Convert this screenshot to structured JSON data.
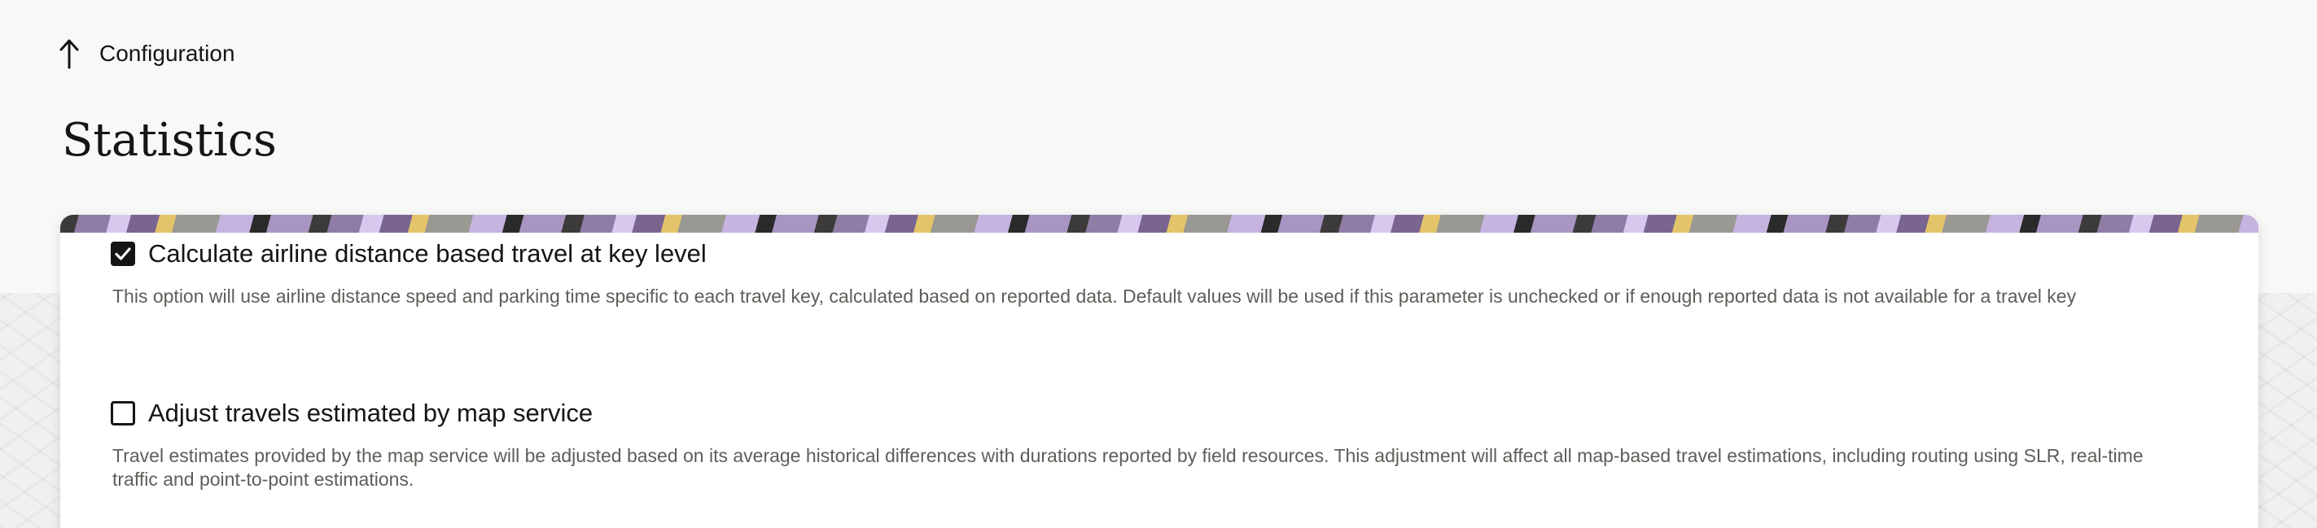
{
  "nav": {
    "up_label": "Configuration",
    "up_icon": "arrow-up-icon"
  },
  "page": {
    "title": "Statistics"
  },
  "options": [
    {
      "label": "Calculate airline distance based travel at key level",
      "checked": true,
      "description": "This option will use airline distance speed and parking time specific to each travel key, calculated based on reported data. Default values will be used if this parameter is unchecked or if enough reported data is not available for a travel key"
    },
    {
      "label": "Adjust travels estimated by map service",
      "checked": false,
      "description": "Travel estimates provided by the map service will be adjusted based on its average historical differences with durations reported by field resources. This adjustment will affect all map-based travel estimations, including routing using SLR, real-time traffic and point-to-point estimations."
    }
  ],
  "colors": {
    "text": "#161513",
    "description": "#5f5d58",
    "background": "#f8f8f7",
    "card": "#ffffff",
    "banner_purple": "#8f7da6",
    "banner_gold": "#e4c46a"
  }
}
